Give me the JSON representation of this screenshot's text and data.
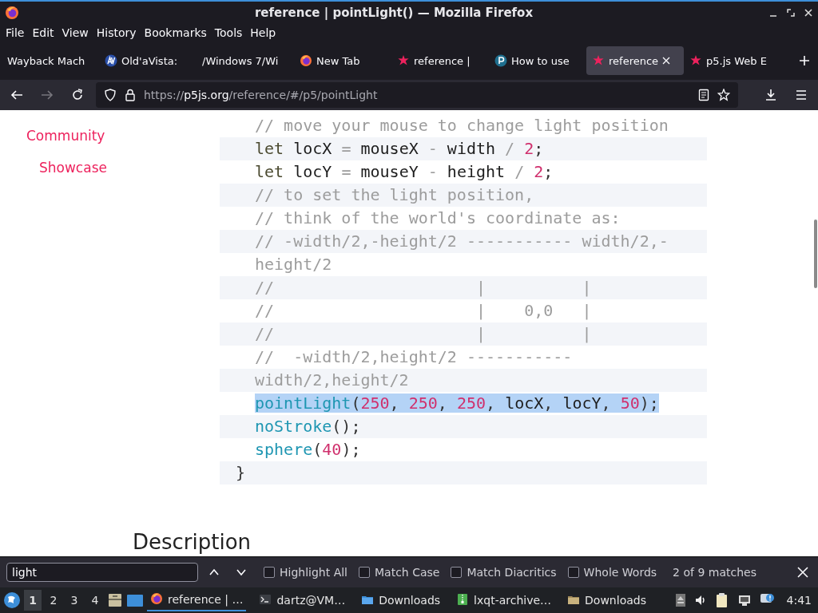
{
  "window": {
    "title": "reference | pointLight() — Mozilla Firefox"
  },
  "menu_bar": [
    "File",
    "Edit",
    "View",
    "History",
    "Bookmarks",
    "Tools",
    "Help"
  ],
  "tabs": [
    {
      "label": "Wayback Mach",
      "kind": "blank",
      "selected": false
    },
    {
      "label": "Old'aVista:",
      "kind": "av",
      "selected": false
    },
    {
      "label": "/Windows 7/Wi",
      "kind": "blank",
      "selected": false
    },
    {
      "label": "New Tab",
      "kind": "firefox",
      "selected": false
    },
    {
      "label": "reference |",
      "kind": "star",
      "selected": false
    },
    {
      "label": "How to use",
      "kind": "p",
      "selected": false
    },
    {
      "label": "reference",
      "kind": "star",
      "selected": true
    },
    {
      "label": "p5.js Web E",
      "kind": "star",
      "selected": false
    }
  ],
  "address_bar": {
    "scheme": "https://",
    "host": "p5js.org",
    "path": "/reference/#/p5/pointLight"
  },
  "sidebar": {
    "items": [
      {
        "label": "Community",
        "children": [
          {
            "label": "Showcase"
          }
        ]
      }
    ]
  },
  "code": {
    "lines": [
      {
        "highlighted": false,
        "tokens": [
          {
            "kind": "comment",
            "text": "// move your mouse to change light position"
          }
        ]
      },
      {
        "highlighted": false,
        "tokens": [
          {
            "kind": "keyword",
            "text": "let"
          },
          {
            "kind": "ident",
            "text": " locX "
          },
          {
            "kind": "op",
            "text": "="
          },
          {
            "kind": "ident",
            "text": " mouseX "
          },
          {
            "kind": "op",
            "text": "-"
          },
          {
            "kind": "ident",
            "text": " width "
          },
          {
            "kind": "op",
            "text": "/"
          },
          {
            "kind": "number",
            "text": " 2"
          },
          {
            "kind": "punct",
            "text": ";"
          }
        ]
      },
      {
        "highlighted": false,
        "tokens": [
          {
            "kind": "keyword",
            "text": "let"
          },
          {
            "kind": "ident",
            "text": " locY "
          },
          {
            "kind": "op",
            "text": "="
          },
          {
            "kind": "ident",
            "text": " mouseY "
          },
          {
            "kind": "op",
            "text": "-"
          },
          {
            "kind": "ident",
            "text": " height "
          },
          {
            "kind": "op",
            "text": "/"
          },
          {
            "kind": "number",
            "text": " 2"
          },
          {
            "kind": "punct",
            "text": ";"
          }
        ]
      },
      {
        "highlighted": false,
        "tokens": [
          {
            "kind": "comment",
            "text": "// to set the light position,"
          }
        ]
      },
      {
        "highlighted": false,
        "tokens": [
          {
            "kind": "comment",
            "text": "// think of the world's coordinate as:"
          }
        ]
      },
      {
        "highlighted": false,
        "tokens": [
          {
            "kind": "comment",
            "text": "// -width/2,-height/2 ----------- width/2,-height/2"
          }
        ]
      },
      {
        "highlighted": false,
        "tokens": [
          {
            "kind": "comment",
            "text": "//                     |          |"
          }
        ]
      },
      {
        "highlighted": false,
        "tokens": [
          {
            "kind": "comment",
            "text": "//                     |    0,0   |"
          }
        ]
      },
      {
        "highlighted": false,
        "tokens": [
          {
            "kind": "comment",
            "text": "//                     |          |"
          }
        ]
      },
      {
        "highlighted": false,
        "tokens": [
          {
            "kind": "comment",
            "text": "//  -width/2,height/2 ----------- width/2,height/2"
          }
        ]
      },
      {
        "highlighted": true,
        "tokens": [
          {
            "kind": "func",
            "text": "pointLight"
          },
          {
            "kind": "punct",
            "text": "("
          },
          {
            "kind": "number",
            "text": "250"
          },
          {
            "kind": "punct",
            "text": ", "
          },
          {
            "kind": "number",
            "text": "250"
          },
          {
            "kind": "punct",
            "text": ", "
          },
          {
            "kind": "number",
            "text": "250"
          },
          {
            "kind": "punct",
            "text": ", "
          },
          {
            "kind": "ident",
            "text": "locX"
          },
          {
            "kind": "punct",
            "text": ", "
          },
          {
            "kind": "ident",
            "text": "locY"
          },
          {
            "kind": "punct",
            "text": ", "
          },
          {
            "kind": "number",
            "text": "50"
          },
          {
            "kind": "punct",
            "text": ");"
          }
        ]
      },
      {
        "highlighted": false,
        "tokens": [
          {
            "kind": "func",
            "text": "noStroke"
          },
          {
            "kind": "punct",
            "text": "();"
          }
        ]
      },
      {
        "highlighted": false,
        "tokens": [
          {
            "kind": "func",
            "text": "sphere"
          },
          {
            "kind": "punct",
            "text": "("
          },
          {
            "kind": "number",
            "text": "40"
          },
          {
            "kind": "punct",
            "text": ");"
          }
        ]
      }
    ],
    "closing_line": "}"
  },
  "description_heading": "Description",
  "find_bar": {
    "query": "light",
    "options": [
      {
        "label": "Highlight All",
        "checked": false
      },
      {
        "label": "Match Case",
        "checked": false
      },
      {
        "label": "Match Diacritics",
        "checked": false
      },
      {
        "label": "Whole Words",
        "checked": false
      }
    ],
    "result": "2 of 9 matches"
  },
  "taskbar": {
    "desktops": [
      {
        "label": "1",
        "selected": true
      },
      {
        "label": "2",
        "selected": false
      },
      {
        "label": "3",
        "selected": false
      },
      {
        "label": "4",
        "selected": false
      }
    ],
    "tasks": [
      {
        "label": "reference | …",
        "kind": "firefox",
        "selected": true
      },
      {
        "label": "dartz@VM…",
        "kind": "terminal",
        "selected": false
      },
      {
        "label": "Downloads",
        "kind": "folder",
        "selected": false
      },
      {
        "label": "lxqt-archive…",
        "kind": "archive",
        "selected": false
      },
      {
        "label": "Downloads",
        "kind": "folder2",
        "selected": false
      }
    ],
    "clock": "4:41"
  }
}
